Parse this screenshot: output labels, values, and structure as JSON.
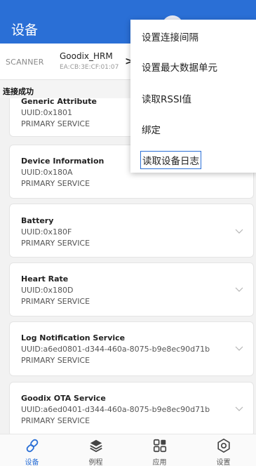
{
  "app": {
    "title": "设备"
  },
  "tabs": {
    "scanner": "SCANNER",
    "device": {
      "name": "Goodix_HRM",
      "mac": "EA:CB:3E:CF:01:07"
    }
  },
  "status": "连接成功",
  "services": [
    {
      "name": "Generic Attribute",
      "uuid": "UUID:0x1801",
      "type": "PRIMARY SERVICE"
    },
    {
      "name": "Device Information",
      "uuid": "UUID:0x180A",
      "type": "PRIMARY SERVICE"
    },
    {
      "name": "Battery",
      "uuid": "UUID:0x180F",
      "type": "PRIMARY SERVICE"
    },
    {
      "name": "Heart Rate",
      "uuid": "UUID:0x180D",
      "type": "PRIMARY SERVICE"
    },
    {
      "name": "Log Notification Service",
      "uuid": "UUID:a6ed0801-d344-460a-8075-b9e8ec90d71b",
      "type": "PRIMARY SERVICE"
    },
    {
      "name": "Goodix OTA Service",
      "uuid": "UUID:a6ed0401-d344-460a-8075-b9e8ec90d71b",
      "type": "PRIMARY SERVICE"
    }
  ],
  "menu": {
    "items": [
      "设置连接间隔",
      "设置最大数据单元",
      "读取RSSI值",
      "绑定",
      "读取设备日志"
    ]
  },
  "bottom_nav": {
    "items": [
      {
        "label": "设备",
        "icon": "link-icon",
        "active": true
      },
      {
        "label": "例程",
        "icon": "layers-icon",
        "active": false
      },
      {
        "label": "应用",
        "icon": "apps-grid-icon",
        "active": false
      },
      {
        "label": "设置",
        "icon": "settings-gear-icon",
        "active": false
      }
    ]
  },
  "colors": {
    "primary": "#2a6fd6",
    "background": "#f2f2f2"
  }
}
